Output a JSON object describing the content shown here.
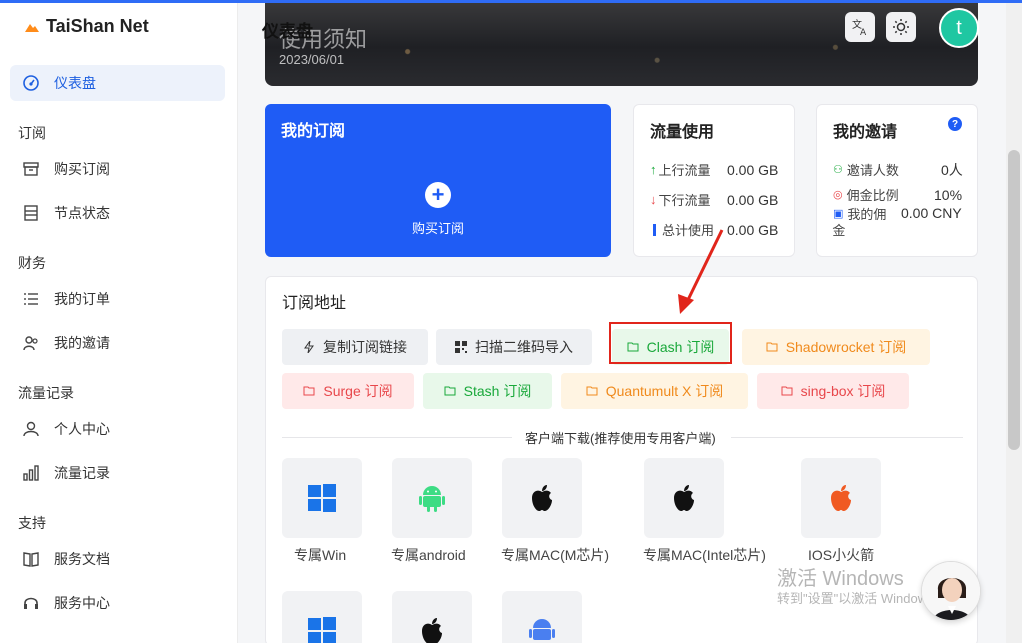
{
  "app": {
    "name": "TaiShan Net",
    "page_title": "仪表盘"
  },
  "colors": {
    "accent": "#1f5cf5",
    "brand": "#ff8c1a",
    "avatar": "#1fc7a2",
    "highlight_box": "#e1251b"
  },
  "sidebar": {
    "active": {
      "label": "仪表盘",
      "icon": "dashboard-icon"
    },
    "sections": [
      {
        "title": "订阅",
        "items": [
          {
            "label": "购买订阅",
            "icon": "box-icon"
          },
          {
            "label": "节点状态",
            "icon": "server-icon"
          }
        ]
      },
      {
        "title": "财务",
        "items": [
          {
            "label": "我的订单",
            "icon": "list-icon"
          },
          {
            "label": "我的邀请",
            "icon": "users-icon"
          }
        ]
      },
      {
        "title": "流量记录",
        "items": [
          {
            "label": "个人中心",
            "icon": "user-icon"
          },
          {
            "label": "流量记录",
            "icon": "bar-chart-icon"
          }
        ]
      },
      {
        "title": "支持",
        "items": [
          {
            "label": "服务文档",
            "icon": "book-icon"
          },
          {
            "label": "服务中心",
            "icon": "headset-icon"
          }
        ]
      }
    ]
  },
  "header": {
    "avatar_letter": "t",
    "translate_icon": "translate-icon",
    "theme_icon": "sun-icon"
  },
  "banner": {
    "title": "使用须知",
    "date": "2023/06/01"
  },
  "subscription": {
    "title": "我的订阅",
    "action": "购买订阅"
  },
  "traffic": {
    "title": "流量使用",
    "rows": [
      {
        "label": "上行流量",
        "value": "0.00 GB"
      },
      {
        "label": "下行流量",
        "value": "0.00 GB"
      },
      {
        "label": "总计使用",
        "value": "0.00 GB"
      }
    ]
  },
  "invite": {
    "title": "我的邀请",
    "rows": [
      {
        "label": "邀请人数",
        "value": "0人"
      },
      {
        "label": "佣金比例",
        "value": "10%"
      },
      {
        "label_line1": "我的佣",
        "label_line2": "金",
        "value": "0.00 CNY"
      }
    ]
  },
  "sub_url": {
    "title": "订阅地址",
    "buttons": [
      {
        "label": "复制订阅链接"
      },
      {
        "label": "扫描二维码导入"
      },
      {
        "label": "Clash 订阅"
      },
      {
        "label": "Shadowrocket 订阅"
      },
      {
        "label": "Surge 订阅"
      },
      {
        "label": "Stash 订阅"
      },
      {
        "label": "Quantumult X 订阅"
      },
      {
        "label": "sing-box 订阅"
      }
    ],
    "download_title": "客户端下载(推荐使用专用客户端)",
    "downloads": [
      {
        "label": "专属Win",
        "icon": "windows-icon"
      },
      {
        "label": "专属android",
        "icon": "android-icon"
      },
      {
        "label": "专属MAC(M芯片)",
        "icon": "apple-icon"
      },
      {
        "label": "专属MAC(Intel芯片)",
        "icon": "apple-icon"
      },
      {
        "label": "IOS小火箭",
        "icon": "apple-icon"
      }
    ]
  },
  "watermark": {
    "line1": "激活 Windows",
    "line2": "转到\"设置\"以激活 Windows。"
  }
}
